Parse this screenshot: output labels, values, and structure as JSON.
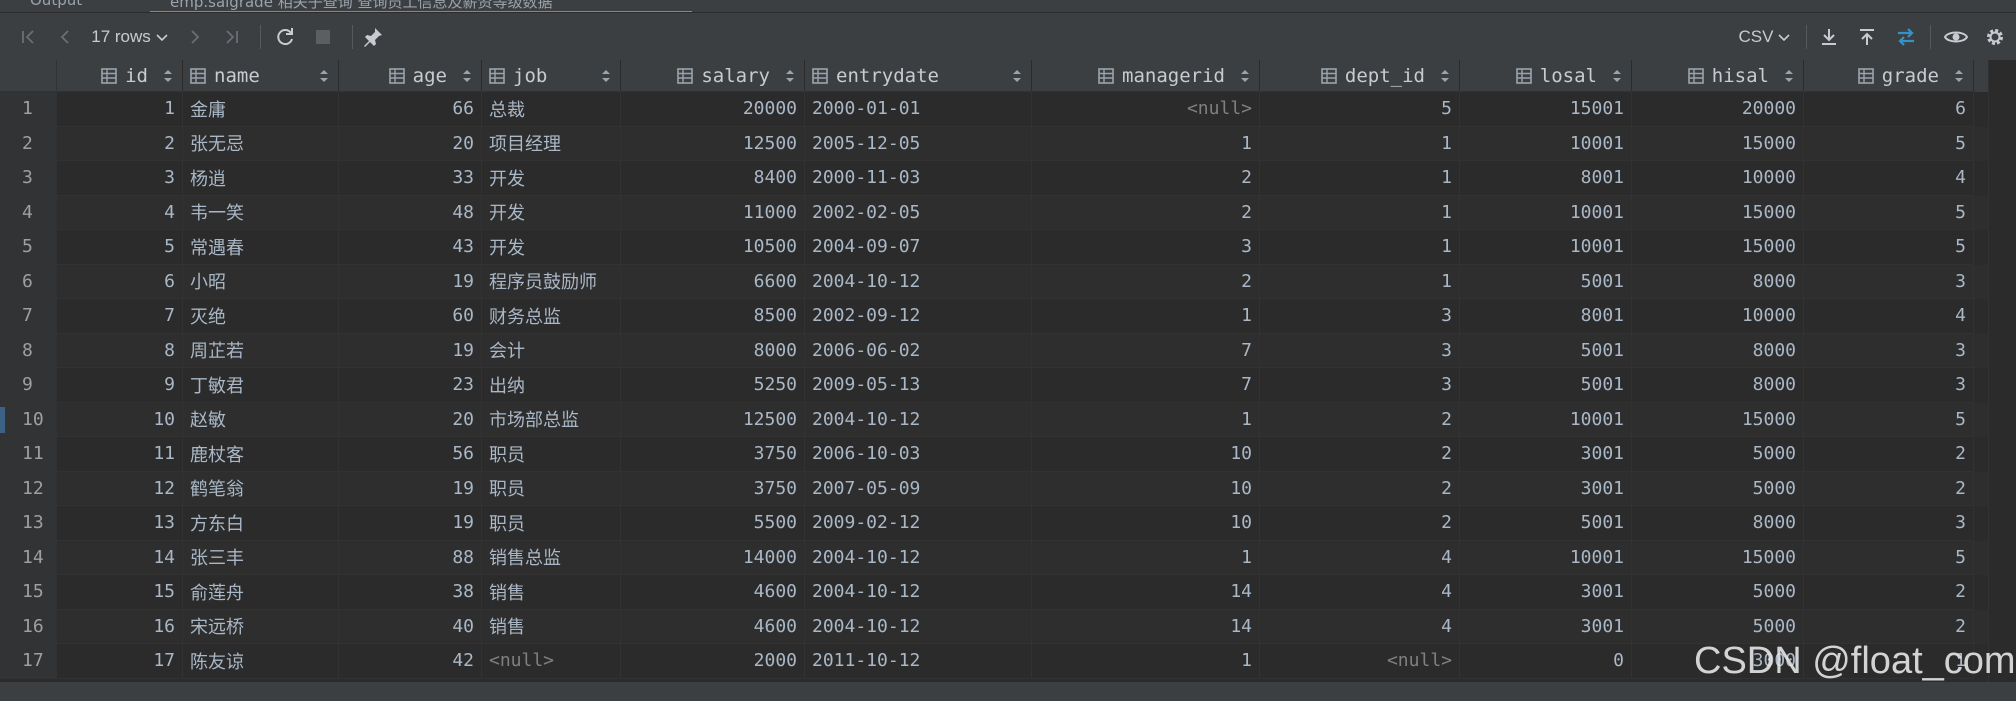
{
  "tabs": [
    {
      "label": "Output"
    },
    {
      "label": "emp.salgrade 相关子查询 查询员工信息及薪资等级数据"
    }
  ],
  "toolbar": {
    "rows_label": "17 rows",
    "format_label": "CSV"
  },
  "columns": [
    {
      "label": "id"
    },
    {
      "label": "name"
    },
    {
      "label": "age"
    },
    {
      "label": "job"
    },
    {
      "label": "salary"
    },
    {
      "label": "entrydate"
    },
    {
      "label": "managerid"
    },
    {
      "label": "dept_id"
    },
    {
      "label": "losal"
    },
    {
      "label": "hisal"
    },
    {
      "label": "grade"
    }
  ],
  "rows": [
    {
      "n": "1",
      "id": "1",
      "name": "金庸",
      "age": "66",
      "job": "总裁",
      "salary": "20000",
      "entrydate": "2000-01-01",
      "managerid": "<null>",
      "dept_id": "5",
      "losal": "15001",
      "hisal": "20000",
      "grade": "6"
    },
    {
      "n": "2",
      "id": "2",
      "name": "张无忌",
      "age": "20",
      "job": "项目经理",
      "salary": "12500",
      "entrydate": "2005-12-05",
      "managerid": "1",
      "dept_id": "1",
      "losal": "10001",
      "hisal": "15000",
      "grade": "5"
    },
    {
      "n": "3",
      "id": "3",
      "name": "杨逍",
      "age": "33",
      "job": "开发",
      "salary": "8400",
      "entrydate": "2000-11-03",
      "managerid": "2",
      "dept_id": "1",
      "losal": "8001",
      "hisal": "10000",
      "grade": "4"
    },
    {
      "n": "4",
      "id": "4",
      "name": "韦一笑",
      "age": "48",
      "job": "开发",
      "salary": "11000",
      "entrydate": "2002-02-05",
      "managerid": "2",
      "dept_id": "1",
      "losal": "10001",
      "hisal": "15000",
      "grade": "5"
    },
    {
      "n": "5",
      "id": "5",
      "name": "常遇春",
      "age": "43",
      "job": "开发",
      "salary": "10500",
      "entrydate": "2004-09-07",
      "managerid": "3",
      "dept_id": "1",
      "losal": "10001",
      "hisal": "15000",
      "grade": "5"
    },
    {
      "n": "6",
      "id": "6",
      "name": "小昭",
      "age": "19",
      "job": "程序员鼓励师",
      "salary": "6600",
      "entrydate": "2004-10-12",
      "managerid": "2",
      "dept_id": "1",
      "losal": "5001",
      "hisal": "8000",
      "grade": "3"
    },
    {
      "n": "7",
      "id": "7",
      "name": "灭绝",
      "age": "60",
      "job": "财务总监",
      "salary": "8500",
      "entrydate": "2002-09-12",
      "managerid": "1",
      "dept_id": "3",
      "losal": "8001",
      "hisal": "10000",
      "grade": "4"
    },
    {
      "n": "8",
      "id": "8",
      "name": "周芷若",
      "age": "19",
      "job": "会计",
      "salary": "8000",
      "entrydate": "2006-06-02",
      "managerid": "7",
      "dept_id": "3",
      "losal": "5001",
      "hisal": "8000",
      "grade": "3"
    },
    {
      "n": "9",
      "id": "9",
      "name": "丁敏君",
      "age": "23",
      "job": "出纳",
      "salary": "5250",
      "entrydate": "2009-05-13",
      "managerid": "7",
      "dept_id": "3",
      "losal": "5001",
      "hisal": "8000",
      "grade": "3"
    },
    {
      "n": "10",
      "id": "10",
      "name": "赵敏",
      "age": "20",
      "job": "市场部总监",
      "salary": "12500",
      "entrydate": "2004-10-12",
      "managerid": "1",
      "dept_id": "2",
      "losal": "10001",
      "hisal": "15000",
      "grade": "5"
    },
    {
      "n": "11",
      "id": "11",
      "name": "鹿杖客",
      "age": "56",
      "job": "职员",
      "salary": "3750",
      "entrydate": "2006-10-03",
      "managerid": "10",
      "dept_id": "2",
      "losal": "3001",
      "hisal": "5000",
      "grade": "2"
    },
    {
      "n": "12",
      "id": "12",
      "name": "鹤笔翁",
      "age": "19",
      "job": "职员",
      "salary": "3750",
      "entrydate": "2007-05-09",
      "managerid": "10",
      "dept_id": "2",
      "losal": "3001",
      "hisal": "5000",
      "grade": "2"
    },
    {
      "n": "13",
      "id": "13",
      "name": "方东白",
      "age": "19",
      "job": "职员",
      "salary": "5500",
      "entrydate": "2009-02-12",
      "managerid": "10",
      "dept_id": "2",
      "losal": "5001",
      "hisal": "8000",
      "grade": "3"
    },
    {
      "n": "14",
      "id": "14",
      "name": "张三丰",
      "age": "88",
      "job": "销售总监",
      "salary": "14000",
      "entrydate": "2004-10-12",
      "managerid": "1",
      "dept_id": "4",
      "losal": "10001",
      "hisal": "15000",
      "grade": "5"
    },
    {
      "n": "15",
      "id": "15",
      "name": "俞莲舟",
      "age": "38",
      "job": "销售",
      "salary": "4600",
      "entrydate": "2004-10-12",
      "managerid": "14",
      "dept_id": "4",
      "losal": "3001",
      "hisal": "5000",
      "grade": "2"
    },
    {
      "n": "16",
      "id": "16",
      "name": "宋远桥",
      "age": "40",
      "job": "销售",
      "salary": "4600",
      "entrydate": "2004-10-12",
      "managerid": "14",
      "dept_id": "4",
      "losal": "3001",
      "hisal": "5000",
      "grade": "2"
    },
    {
      "n": "17",
      "id": "17",
      "name": "陈友谅",
      "age": "42",
      "job": "<null>",
      "salary": "2000",
      "entrydate": "2011-10-12",
      "managerid": "1",
      "dept_id": "<null>",
      "losal": "0",
      "hisal": "3000",
      "grade": "1"
    }
  ],
  "watermark": "CSDN @float_com",
  "colors": {
    "background": "#2b2b2b",
    "header": "#3c3f41",
    "null_text": "#808080",
    "accent": "#3592c4"
  }
}
